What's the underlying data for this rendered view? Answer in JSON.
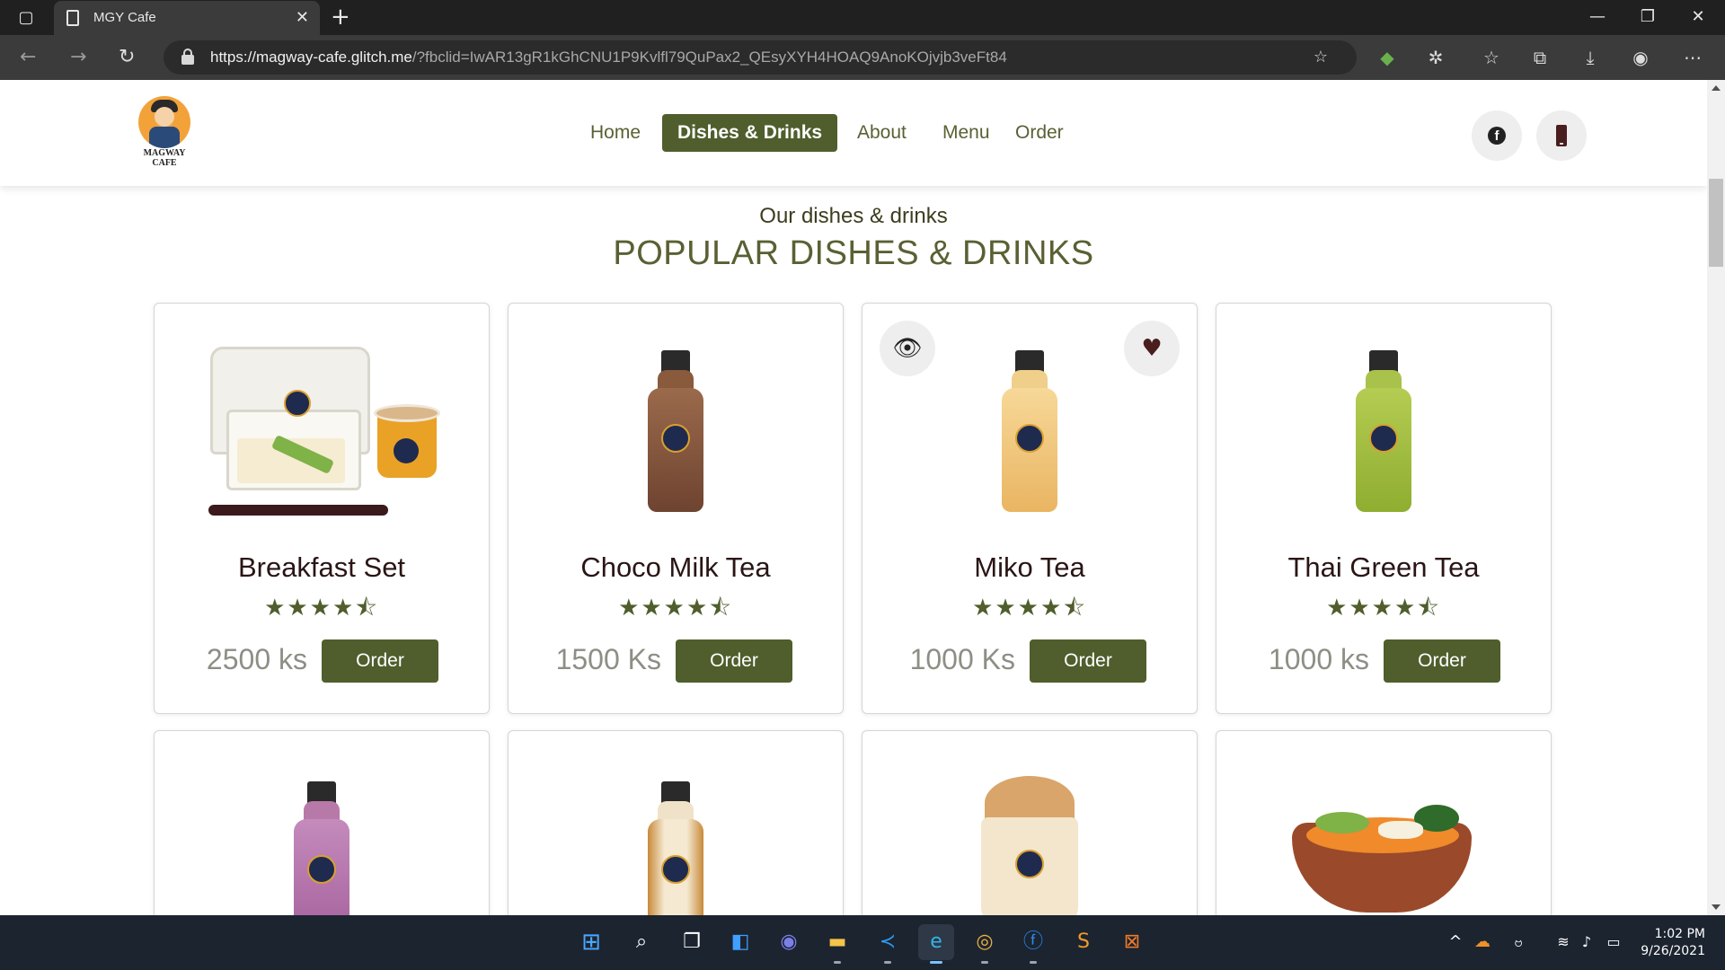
{
  "browser": {
    "tab_title": "MGY Cafe",
    "url_host": "https://magway-cafe.glitch.me",
    "url_rest": "/?fbclid=IwAR13gR1kGhCNU1P9Kvlfl79QuPax2_QEsyXYH4HOAQ9AnoKOjvjb3veFt84"
  },
  "site": {
    "logo_text_line1": "MAGWAY",
    "logo_text_line2": "CAFE",
    "nav": [
      {
        "label": "Home",
        "active": false
      },
      {
        "label": "Dishes & Drinks",
        "active": true
      },
      {
        "label": "About",
        "active": false
      },
      {
        "label": "Menu",
        "active": false
      },
      {
        "label": "Order",
        "active": false
      }
    ],
    "social": [
      "facebook-icon",
      "phone-icon"
    ],
    "colors": {
      "accent": "#4f5e2c",
      "nav_text": "#5a6033",
      "price": "#8e8e85"
    }
  },
  "section": {
    "subtitle": "Our dishes & drinks",
    "title": "POPULAR DISHES & DRINKS"
  },
  "products": [
    {
      "name": "Breakfast Set",
      "price": "2500 ks",
      "rating": 4.5,
      "order_label": "Order"
    },
    {
      "name": "Choco Milk Tea",
      "price": "1500 Ks",
      "rating": 4.5,
      "order_label": "Order"
    },
    {
      "name": "Miko Tea",
      "price": "1000 Ks",
      "rating": 4.5,
      "order_label": "Order"
    },
    {
      "name": "Thai Green Tea",
      "price": "1000 ks",
      "rating": 4.5,
      "order_label": "Order"
    }
  ],
  "stars_glyph": "★★★★⯪",
  "taskbar": {
    "time": "1:02 PM",
    "date": "9/26/2021"
  }
}
